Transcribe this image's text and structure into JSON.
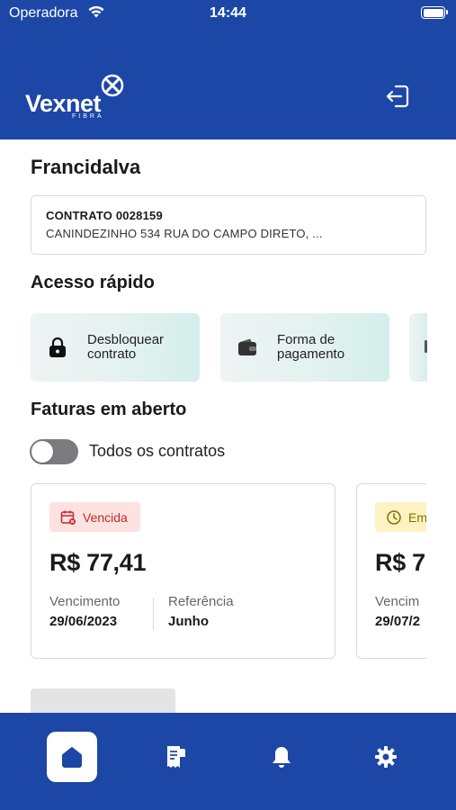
{
  "status_bar": {
    "carrier": "Operadora",
    "time": "14:44"
  },
  "brand": {
    "name": "Vexnet",
    "tagline": "FIBRA"
  },
  "user": {
    "name": "Francidalva"
  },
  "contract": {
    "number": "CONTRATO 0028159",
    "address": "CANINDEZINHO 534 RUA DO CAMPO DIRETO, ..."
  },
  "quick_access": {
    "title": "Acesso rápido",
    "items": [
      {
        "label": "Desbloquear contrato",
        "icon": "lock-icon"
      },
      {
        "label": "Forma de pagamento",
        "icon": "wallet-icon"
      }
    ]
  },
  "invoices": {
    "title": "Faturas em aberto",
    "toggle_label": "Todos os contratos",
    "toggle_on": false,
    "labels": {
      "due": "Vencimento",
      "reference": "Referência"
    },
    "items": [
      {
        "status": "Vencida",
        "amount": "R$ 77,41",
        "due_date": "29/06/2023",
        "reference": "Junho",
        "status_color": "#c62828",
        "status_bg": "#fde2e2"
      },
      {
        "status": "Em",
        "amount": "R$ 7",
        "due_label": "Vencim",
        "due_date": "29/07/2",
        "status_color": "#8a6d00",
        "status_bg": "#fdf3c2"
      }
    ]
  },
  "tabbar": {
    "items": [
      {
        "name": "home",
        "icon": "home-icon",
        "active": true
      },
      {
        "name": "invoices",
        "icon": "receipt-icon",
        "active": false
      },
      {
        "name": "notifications",
        "icon": "bell-icon",
        "active": false
      },
      {
        "name": "settings",
        "icon": "gear-icon",
        "active": false
      }
    ]
  },
  "colors": {
    "primary": "#1d47a6",
    "teal_tint": "#e3f2f0"
  }
}
